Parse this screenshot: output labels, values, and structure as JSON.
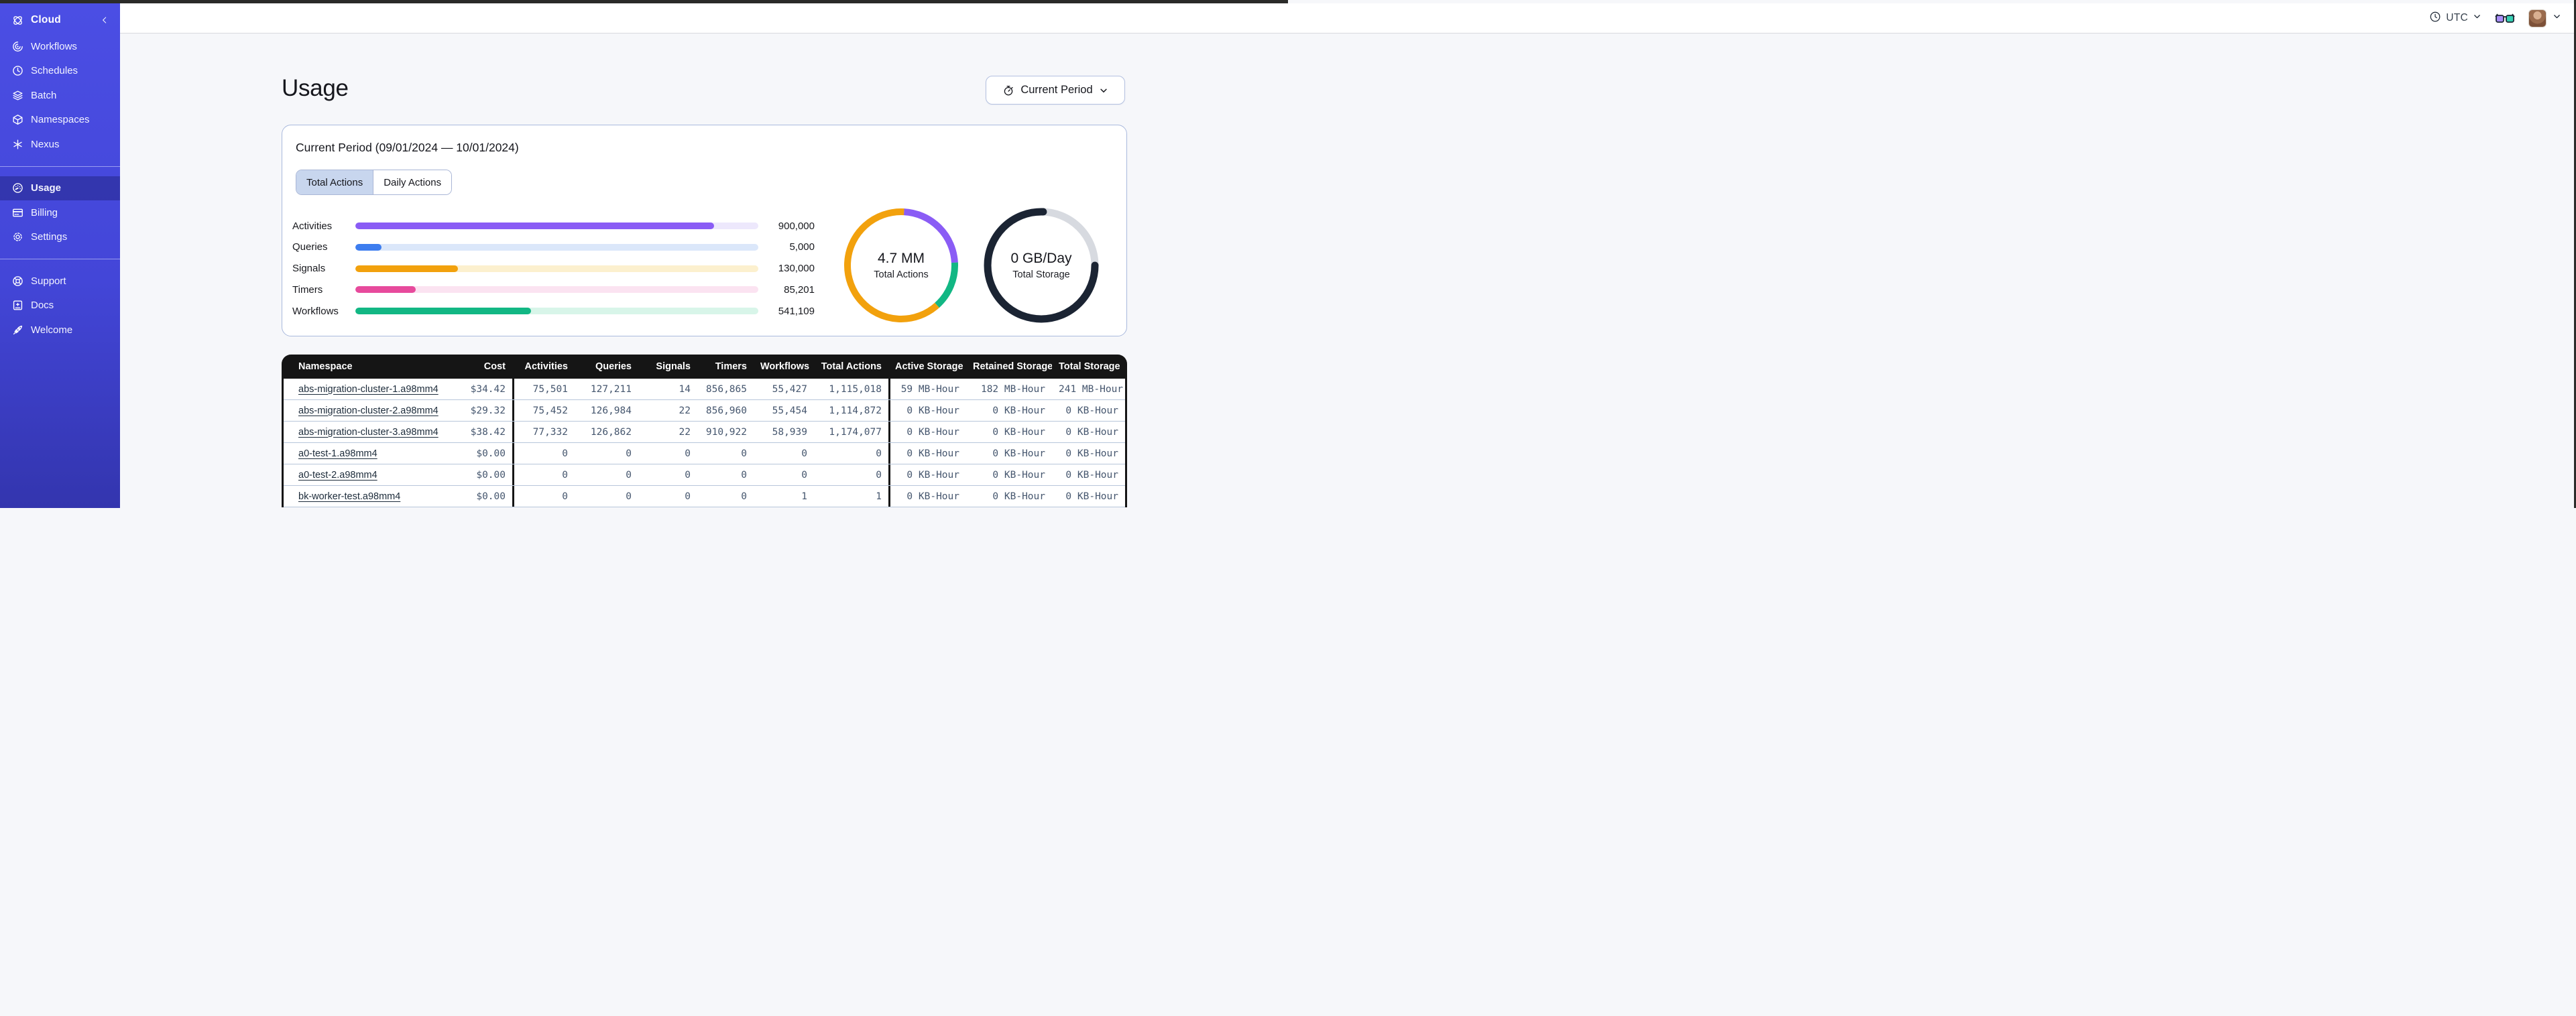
{
  "topbar": {
    "timezone": "UTC"
  },
  "sidebar": {
    "brand": "Cloud",
    "sections": [
      {
        "items": [
          {
            "label": "Workflows"
          },
          {
            "label": "Schedules"
          },
          {
            "label": "Batch"
          },
          {
            "label": "Namespaces"
          },
          {
            "label": "Nexus"
          }
        ]
      },
      {
        "items": [
          {
            "label": "Usage",
            "active": true
          },
          {
            "label": "Billing"
          },
          {
            "label": "Settings"
          }
        ]
      },
      {
        "items": [
          {
            "label": "Support"
          },
          {
            "label": "Docs"
          },
          {
            "label": "Welcome"
          }
        ]
      }
    ]
  },
  "page": {
    "title": "Usage",
    "period_button_label": "Current Period"
  },
  "card": {
    "title": "Current Period (09/01/2024 — 10/01/2024)",
    "tabs": {
      "total": "Total Actions",
      "daily": "Daily Actions"
    }
  },
  "chart_data": [
    {
      "type": "bar",
      "title": "Current period usage by action type",
      "categories": [
        "Activities",
        "Queries",
        "Signals",
        "Timers",
        "Workflows"
      ],
      "values": [
        900000,
        5000,
        130000,
        85201,
        541109
      ],
      "display_values": [
        "900,000",
        "5,000",
        "130,000",
        "85,201",
        "541,109"
      ],
      "bar_fill_percents": [
        89,
        6.5,
        25.5,
        15,
        43.6
      ],
      "colors": [
        "#8A5CF5",
        "#3D7DEF",
        "#F2A10D",
        "#E74A9C",
        "#12B784"
      ],
      "track_colors": [
        "#EDE8FC",
        "#DBE7FA",
        "#FCF0CE",
        "#FBE3F1",
        "#D8F5E9"
      ],
      "legend_position": "none",
      "grid": false
    },
    {
      "type": "pie",
      "label": "4.7 MM",
      "sublabel": "Total Actions",
      "segments": [
        {
          "name": "purple",
          "color": "#8A5CF5",
          "from": 3,
          "to": 87
        },
        {
          "name": "green",
          "color": "#12B784",
          "from": 87,
          "to": 138
        },
        {
          "name": "orange",
          "color": "#F2A10D",
          "from": 138,
          "to": 363
        }
      ]
    },
    {
      "type": "pie",
      "label": "0 GB/Day",
      "sublabel": "Total Storage",
      "ring": "#D7DAE0",
      "segments": [
        {
          "name": "used",
          "color": "#1B2433",
          "from": 90,
          "to": 362,
          "cap": "round"
        }
      ]
    }
  ],
  "table": {
    "columns": [
      "Namespace",
      "Cost",
      "Activities",
      "Queries",
      "Signals",
      "Timers",
      "Workflows",
      "Total Actions",
      "Active Storage",
      "Retained Storage",
      "Total Storage"
    ],
    "rows": [
      {
        "namespace": "abs-migration-cluster-1.a98mm4",
        "cost": "$34.42",
        "activities": "75,501",
        "queries": "127,211",
        "signals": "14",
        "timers": "856,865",
        "workflows": "55,427",
        "total_actions": "1,115,018",
        "active_storage": "59 MB-Hour",
        "retained_storage": "182 MB-Hour",
        "total_storage": "241 MB-Hour"
      },
      {
        "namespace": "abs-migration-cluster-2.a98mm4",
        "cost": "$29.32",
        "activities": "75,452",
        "queries": "126,984",
        "signals": "22",
        "timers": "856,960",
        "workflows": "55,454",
        "total_actions": "1,114,872",
        "active_storage": "0 KB-Hour",
        "retained_storage": "0 KB-Hour",
        "total_storage": "0 KB-Hour"
      },
      {
        "namespace": "abs-migration-cluster-3.a98mm4",
        "cost": "$38.42",
        "activities": "77,332",
        "queries": "126,862",
        "signals": "22",
        "timers": "910,922",
        "workflows": "58,939",
        "total_actions": "1,174,077",
        "active_storage": "0 KB-Hour",
        "retained_storage": "0 KB-Hour",
        "total_storage": "0 KB-Hour"
      },
      {
        "namespace": "a0-test-1.a98mm4",
        "cost": "$0.00",
        "activities": "0",
        "queries": "0",
        "signals": "0",
        "timers": "0",
        "workflows": "0",
        "total_actions": "0",
        "active_storage": "0 KB-Hour",
        "retained_storage": "0 KB-Hour",
        "total_storage": "0 KB-Hour"
      },
      {
        "namespace": "a0-test-2.a98mm4",
        "cost": "$0.00",
        "activities": "0",
        "queries": "0",
        "signals": "0",
        "timers": "0",
        "workflows": "0",
        "total_actions": "0",
        "active_storage": "0 KB-Hour",
        "retained_storage": "0 KB-Hour",
        "total_storage": "0 KB-Hour"
      },
      {
        "namespace": "bk-worker-test.a98mm4",
        "cost": "$0.00",
        "activities": "0",
        "queries": "0",
        "signals": "0",
        "timers": "0",
        "workflows": "1",
        "total_actions": "1",
        "active_storage": "0 KB-Hour",
        "retained_storage": "0 KB-Hour",
        "total_storage": "0 KB-Hour"
      }
    ]
  }
}
